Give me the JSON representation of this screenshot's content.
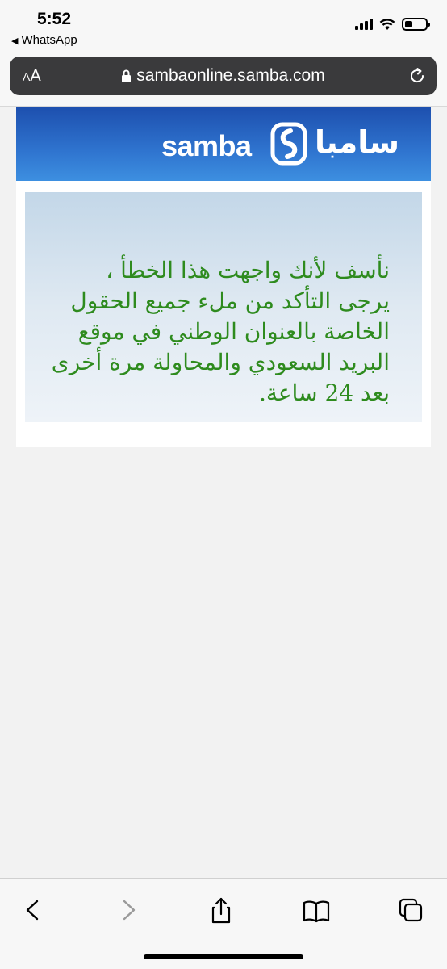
{
  "status_bar": {
    "time": "5:52",
    "back_app": "WhatsApp",
    "back_icon": "back-triangle-icon"
  },
  "browser": {
    "text_size_button": "AA",
    "url": "sambaonline.samba.com",
    "lock_icon": "lock-icon",
    "reload_icon": "reload-icon"
  },
  "page": {
    "brand_en": "samba",
    "brand_ar": "سامبا",
    "header_color": "#2f74cf",
    "message": "نأسف لأنك واجهت هذا الخطأ ، يرجى التأكد من ملء جميع الحقول الخاصة بالعنوان الوطني في موقع البريد السعودي والمحاولة مرة أخرى بعد 24 ساعة.",
    "message_color": "#2e8b1e"
  },
  "toolbar": {
    "back_icon": "chevron-left-icon",
    "forward_icon": "chevron-right-icon",
    "share_icon": "share-icon",
    "bookmarks_icon": "book-icon",
    "tabs_icon": "tabs-icon"
  }
}
